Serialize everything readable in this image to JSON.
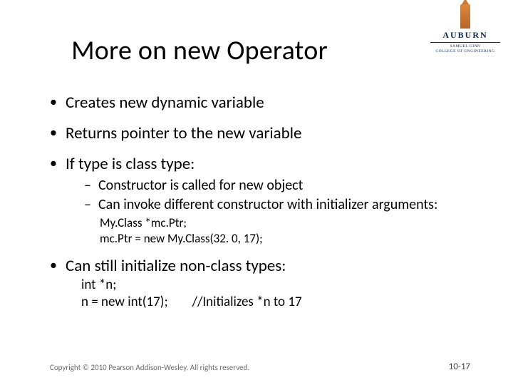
{
  "title": "More on new Operator",
  "logo": {
    "name": "AUBURN",
    "sub1": "SAMUEL GINN",
    "sub2": "COLLEGE OF ENGINEERING"
  },
  "bullets": {
    "b1": "Creates new dynamic variable",
    "b2": "Returns pointer to the new variable",
    "b3": "If type is class type:",
    "b3s1": "Constructor is called for new object",
    "b3s2": "Can invoke different constructor with initializer arguments:",
    "code1a": "My.Class *mc.Ptr;",
    "code1b": "mc.Ptr = new My.Class(32. 0, 17);",
    "b4": "Can still initialize non-class types:",
    "code2a": "int *n;",
    "code2b_left": "n = new int(17);",
    "code2b_right": "//Initializes *n to 17"
  },
  "footer": {
    "copyright": "Copyright © 2010 Pearson Addison-Wesley. All rights reserved.",
    "pageno": "10-17"
  }
}
